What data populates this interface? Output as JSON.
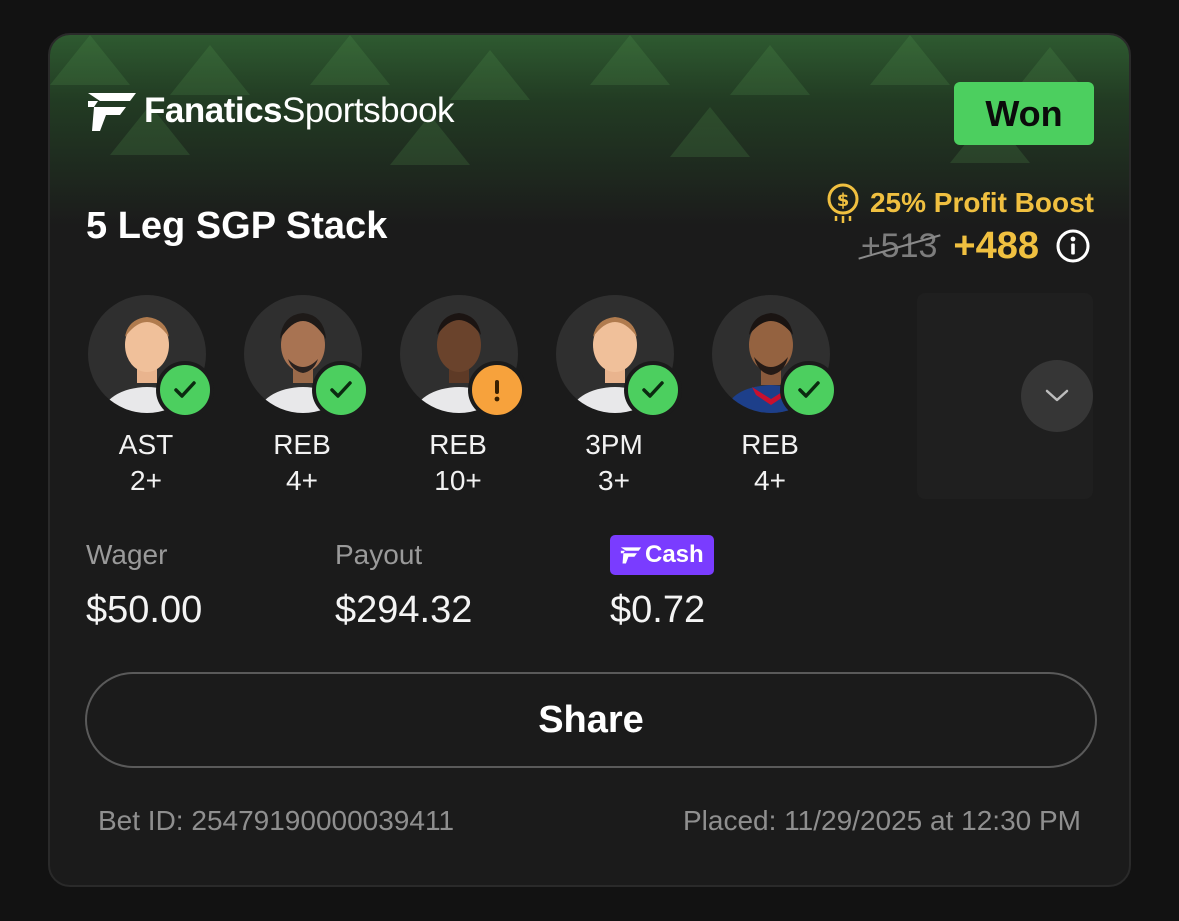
{
  "brand": {
    "name_bold": "Fanatics",
    "name_light": "Sportsbook"
  },
  "status_badge": "Won",
  "bet_title": "5 Leg SGP Stack",
  "boost": {
    "label": "25% Profit Boost",
    "old_odds": "+513",
    "new_odds": "+488"
  },
  "legs": [
    {
      "stat": "AST",
      "line": "2+",
      "status": "won"
    },
    {
      "stat": "REB",
      "line": "4+",
      "status": "won"
    },
    {
      "stat": "REB",
      "line": "10+",
      "status": "warning"
    },
    {
      "stat": "3PM",
      "line": "3+",
      "status": "won"
    },
    {
      "stat": "REB",
      "line": "4+",
      "status": "won"
    }
  ],
  "wager": {
    "label": "Wager",
    "value": "$50.00"
  },
  "payout": {
    "label": "Payout",
    "value": "$294.32"
  },
  "cash": {
    "label": "Cash",
    "value": "$0.72"
  },
  "share_label": "Share",
  "footer": {
    "bet_id": "Bet ID: 25479190000039411",
    "placed": "Placed: 11/29/2025 at 12:30 PM"
  },
  "colors": {
    "won": "#4ccf5f",
    "warning": "#f7a23c",
    "boost": "#f0c040",
    "cash": "#7a3cff"
  }
}
